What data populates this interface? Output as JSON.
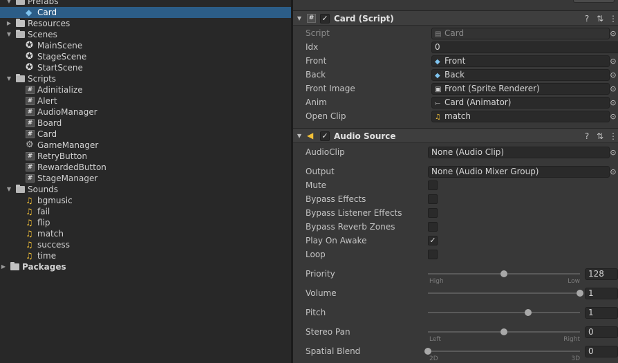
{
  "project_tree": {
    "items": [
      {
        "label": "Prefabs",
        "type": "folder-open",
        "indent": 1,
        "arrow": "open"
      },
      {
        "label": "Card",
        "type": "prefab",
        "indent": 2,
        "selected": true
      },
      {
        "label": "Resources",
        "type": "folder",
        "indent": 1,
        "arrow": "closed"
      },
      {
        "label": "Scenes",
        "type": "folder-open",
        "indent": 1,
        "arrow": "open"
      },
      {
        "label": "MainScene",
        "type": "scene",
        "indent": 2
      },
      {
        "label": "StageScene",
        "type": "scene",
        "indent": 2
      },
      {
        "label": "StartScene",
        "type": "scene",
        "indent": 2
      },
      {
        "label": "Scripts",
        "type": "folder-open",
        "indent": 1,
        "arrow": "open"
      },
      {
        "label": "Adinitialize",
        "type": "script",
        "indent": 2
      },
      {
        "label": "Alert",
        "type": "script",
        "indent": 2
      },
      {
        "label": "AudioManager",
        "type": "script",
        "indent": 2
      },
      {
        "label": "Board",
        "type": "script",
        "indent": 2
      },
      {
        "label": "Card",
        "type": "script",
        "indent": 2
      },
      {
        "label": "GameManager",
        "type": "gear",
        "indent": 2
      },
      {
        "label": "RetryButton",
        "type": "script",
        "indent": 2
      },
      {
        "label": "RewardedButton",
        "type": "script",
        "indent": 2
      },
      {
        "label": "StageManager",
        "type": "script",
        "indent": 2
      },
      {
        "label": "Sounds",
        "type": "folder-open",
        "indent": 1,
        "arrow": "open"
      },
      {
        "label": "bgmusic",
        "type": "audio",
        "indent": 2
      },
      {
        "label": "fail",
        "type": "audio",
        "indent": 2
      },
      {
        "label": "flip",
        "type": "audio",
        "indent": 2
      },
      {
        "label": "match",
        "type": "audio",
        "indent": 2
      },
      {
        "label": "success",
        "type": "audio",
        "indent": 2
      },
      {
        "label": "time",
        "type": "audio",
        "indent": 2
      },
      {
        "label": "Packages",
        "type": "folder",
        "indent": 0,
        "arrow": "closed",
        "bold": true
      }
    ]
  },
  "card_script": {
    "title": "Card (Script)",
    "enabled": true,
    "props": [
      {
        "label": "Script",
        "value": "Card",
        "icon": "script-icon",
        "dim": true
      },
      {
        "label": "Idx",
        "value": "0",
        "icon": ""
      },
      {
        "label": "Front",
        "value": "Front",
        "icon": "cube-icon"
      },
      {
        "label": "Back",
        "value": "Back",
        "icon": "cube-icon"
      },
      {
        "label": "Front Image",
        "value": "Front (Sprite Renderer)",
        "icon": "sprite-renderer-icon"
      },
      {
        "label": "Anim",
        "value": "Card (Animator)",
        "icon": "animator-icon"
      },
      {
        "label": "Open Clip",
        "value": "match",
        "icon": "audio-clip-icon"
      }
    ]
  },
  "audio_source": {
    "title": "Audio Source",
    "enabled": true,
    "audio_clip": {
      "label": "AudioClip",
      "value": "None (Audio Clip)"
    },
    "output": {
      "label": "Output",
      "value": "None (Audio Mixer Group)"
    },
    "toggles": [
      {
        "label": "Mute",
        "checked": false
      },
      {
        "label": "Bypass Effects",
        "checked": false
      },
      {
        "label": "Bypass Listener Effects",
        "checked": false
      },
      {
        "label": "Bypass Reverb Zones",
        "checked": false
      },
      {
        "label": "Play On Awake",
        "checked": true
      },
      {
        "label": "Loop",
        "checked": false
      }
    ],
    "sliders": [
      {
        "label": "Priority",
        "value": "128",
        "fraction": 0.5,
        "min_label": "High",
        "max_label": "Low"
      },
      {
        "label": "Volume",
        "value": "1",
        "fraction": 1.0,
        "min_label": "",
        "max_label": ""
      },
      {
        "label": "Pitch",
        "value": "1",
        "fraction": 0.658,
        "min_label": "",
        "max_label": ""
      },
      {
        "label": "Stereo Pan",
        "value": "0",
        "fraction": 0.5,
        "min_label": "Left",
        "max_label": "Right"
      },
      {
        "label": "Spatial Blend",
        "value": "0",
        "fraction": 0.0,
        "min_label": "2D",
        "max_label": "3D"
      }
    ]
  },
  "icons": {
    "help": "?",
    "presets": "⇅",
    "menu": "⋮",
    "picker": "⊙"
  }
}
